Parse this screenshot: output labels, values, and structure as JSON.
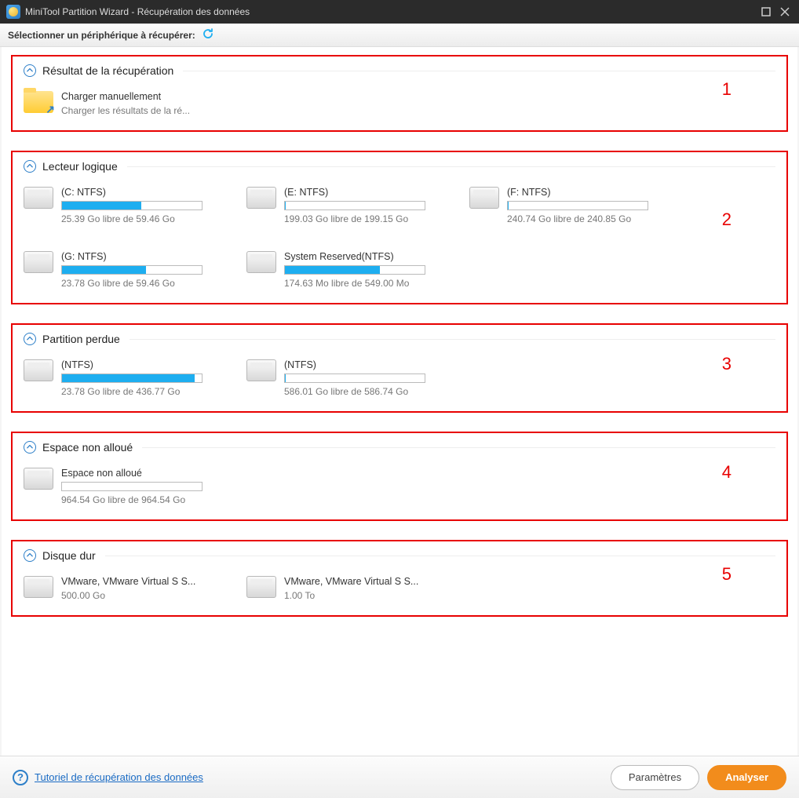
{
  "window": {
    "title": "MiniTool Partition Wizard - Récupération des données"
  },
  "subheader": {
    "label": "Sélectionner un périphérique à récupérer:"
  },
  "sections": [
    {
      "title": "Résultat de la récupération",
      "number": "1",
      "items": [
        {
          "type": "folder",
          "name": "Charger manuellement",
          "sub": "Charger les résultats de la ré..."
        }
      ]
    },
    {
      "title": "Lecteur logique",
      "number": "2",
      "items": [
        {
          "type": "drive",
          "name": "(C: NTFS)",
          "sub": "25.39 Go libre de 59.46 Go",
          "progress": 57
        },
        {
          "type": "drive",
          "name": "(E: NTFS)",
          "sub": "199.03 Go libre de 199.15 Go",
          "progress": 0.1
        },
        {
          "type": "drive",
          "name": "(F: NTFS)",
          "sub": "240.74 Go libre de 240.85 Go",
          "progress": 0.1
        },
        {
          "type": "drive",
          "name": "(G: NTFS)",
          "sub": "23.78 Go libre de 59.46 Go",
          "progress": 60
        },
        {
          "type": "drive",
          "name": "System Reserved(NTFS)",
          "sub": "174.63 Mo libre de 549.00 Mo",
          "progress": 68
        }
      ]
    },
    {
      "title": "Partition perdue",
      "number": "3",
      "items": [
        {
          "type": "drive",
          "name": "(NTFS)",
          "sub": "23.78 Go libre de 436.77 Go",
          "progress": 95
        },
        {
          "type": "drive",
          "name": "(NTFS)",
          "sub": "586.01 Go libre de 586.74 Go",
          "progress": 0.1
        }
      ]
    },
    {
      "title": "Espace non alloué",
      "number": "4",
      "items": [
        {
          "type": "drive",
          "name": "Espace non alloué",
          "sub": "964.54 Go libre de 964.54 Go",
          "progress": 0
        }
      ]
    },
    {
      "title": "Disque dur",
      "number": "5",
      "items": [
        {
          "type": "drive",
          "name": "VMware, VMware Virtual S S...",
          "sub": "500.00 Go"
        },
        {
          "type": "drive",
          "name": "VMware, VMware Virtual S S...",
          "sub": "1.00 To"
        }
      ]
    }
  ],
  "footer": {
    "tutorial_link": "Tutoriel de récupération des données",
    "settings_label": "Paramètres",
    "analyze_label": "Analyser"
  }
}
